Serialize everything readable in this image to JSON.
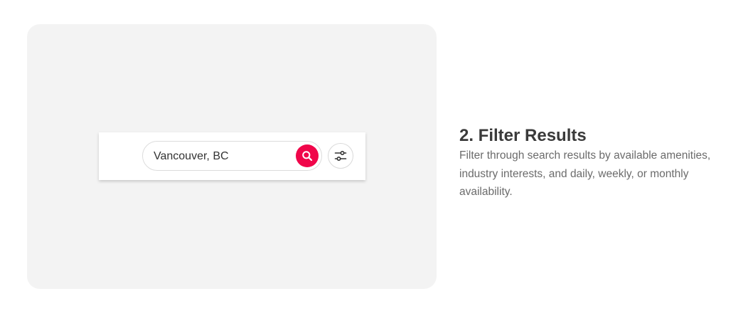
{
  "search": {
    "value": "Vancouver, BC",
    "search_icon": "search-icon",
    "filter_icon": "sliders-icon"
  },
  "feature": {
    "title": "2. Filter Results",
    "description": "Filter through search results by available amenities, industry interests, and daily, weekly, or monthly availability."
  },
  "colors": {
    "accent": "#f0064a",
    "panel_bg": "#f3f3f3",
    "heading": "#3a3a3a",
    "body_text": "#6b6b6b"
  }
}
